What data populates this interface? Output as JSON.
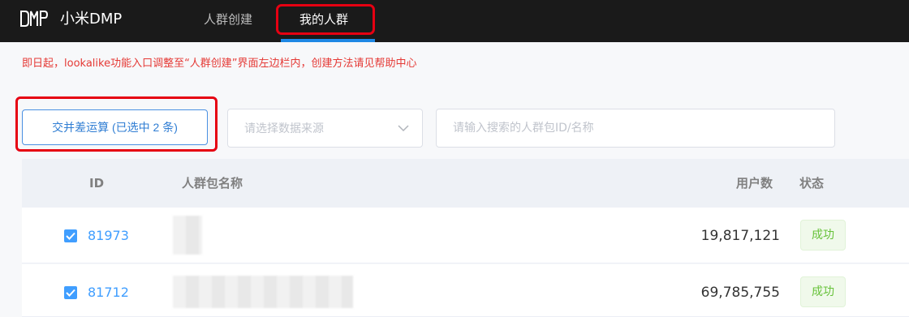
{
  "header": {
    "brand": "小米DMP",
    "logo": "DMP",
    "tabs": [
      {
        "label": "人群创建",
        "active": false
      },
      {
        "label": "我的人群",
        "active": true
      }
    ]
  },
  "notice": "即日起，lookalike功能入口调整至“人群创建”界面左边栏内，创建方法请见帮助中心",
  "toolbar": {
    "operation_button": "交并差运算 (已选中 2 条)",
    "source_select_placeholder": "请选择数据来源",
    "search_placeholder": "请输入搜索的人群包ID/名称"
  },
  "table": {
    "columns": {
      "id": "ID",
      "name": "人群包名称",
      "users": "用户数",
      "status": "状态"
    },
    "rows": [
      {
        "checked": true,
        "id": "81973",
        "name": "",
        "users": "19,817,121",
        "status": "成功"
      },
      {
        "checked": true,
        "id": "81712",
        "name": "",
        "users": "69,785,755",
        "status": "成功"
      }
    ]
  },
  "colors": {
    "accent": "#409eff",
    "highlight": "#e60012",
    "success": "#67c23a",
    "notice": "#e53935"
  }
}
